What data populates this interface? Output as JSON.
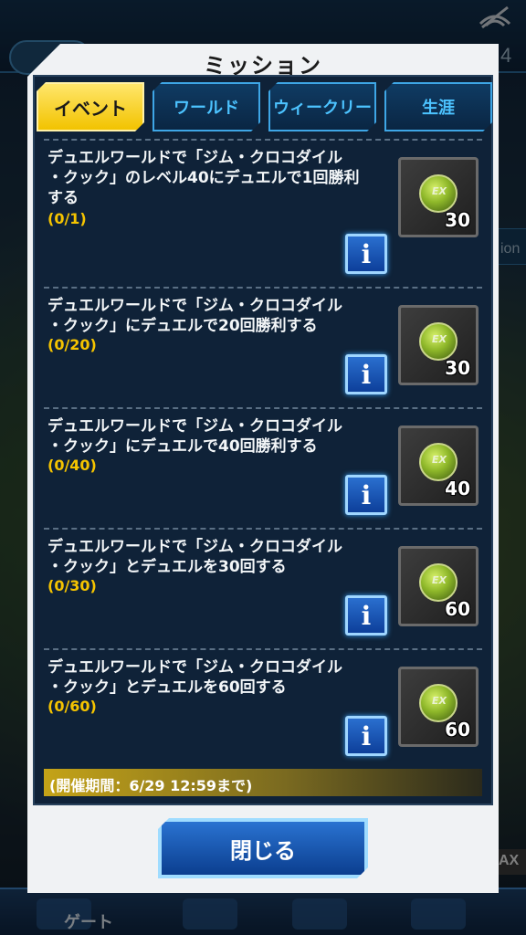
{
  "background": {
    "top_counter": "4",
    "side_label": "ion",
    "max_badge": "AX",
    "bottom_nav_gate_label": "ゲート"
  },
  "modal": {
    "title": "ミッション",
    "tabs": [
      {
        "label": "イベント",
        "active": true
      },
      {
        "label": "ワールド",
        "active": false
      },
      {
        "label": "ウィークリー",
        "active": false
      },
      {
        "label": "生涯",
        "active": false
      }
    ],
    "missions": [
      {
        "line1": "デュエルワールドで「ジム・クロコダイル",
        "line2": "・クック」のレベル40にデュエルで1回勝利",
        "line3": "する",
        "progress": "(0/1)",
        "reward_icon": "ex-orb-icon",
        "reward_label": "EX",
        "reward_qty": "30"
      },
      {
        "line1": "デュエルワールドで「ジム・クロコダイル",
        "line2": "・クック」にデュエルで20回勝利する",
        "line3": "",
        "progress": "(0/20)",
        "reward_icon": "ex-orb-icon",
        "reward_label": "EX",
        "reward_qty": "30"
      },
      {
        "line1": "デュエルワールドで「ジム・クロコダイル",
        "line2": "・クック」にデュエルで40回勝利する",
        "line3": "",
        "progress": "(0/40)",
        "reward_icon": "ex-orb-icon",
        "reward_label": "EX",
        "reward_qty": "40"
      },
      {
        "line1": "デュエルワールドで「ジム・クロコダイル",
        "line2": "・クック」とデュエルを30回する",
        "line3": "",
        "progress": "(0/30)",
        "reward_icon": "ex-orb-icon",
        "reward_label": "EX",
        "reward_qty": "60"
      },
      {
        "line1": "デュエルワールドで「ジム・クロコダイル",
        "line2": "・クック」とデュエルを60回する",
        "line3": "",
        "progress": "(0/60)",
        "reward_icon": "ex-orb-icon",
        "reward_label": "EX",
        "reward_qty": "60"
      }
    ],
    "info_label": "i",
    "period": "(開催期間：6/29 12:59まで)",
    "close_label": "閉じる"
  }
}
